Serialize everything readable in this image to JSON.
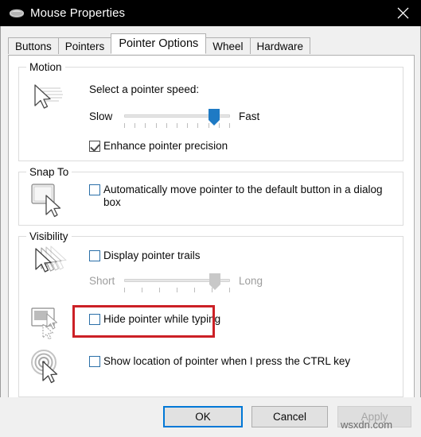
{
  "window": {
    "title": "Mouse Properties",
    "icon": "mouse-icon",
    "close_label": "✕",
    "titlebar_color": "#000000"
  },
  "tabs": [
    {
      "label": "Buttons",
      "active": false
    },
    {
      "label": "Pointers",
      "active": false
    },
    {
      "label": "Pointer Options",
      "active": true
    },
    {
      "label": "Wheel",
      "active": false
    },
    {
      "label": "Hardware",
      "active": false
    }
  ],
  "groups": {
    "motion": {
      "title": "Motion",
      "icon": "cursor-motion-icon",
      "speed_label": "Select a pointer speed:",
      "slider": {
        "min_label": "Slow",
        "max_label": "Fast",
        "value_percent": 85,
        "enabled": true,
        "thumb_color": "#1e7ac4",
        "tick_count": 11
      },
      "checkbox": {
        "label": "Enhance pointer precision",
        "checked": true
      }
    },
    "snapto": {
      "title": "Snap To",
      "icon": "cursor-button-icon",
      "checkbox": {
        "label": "Automatically move pointer to the default button in a dialog box",
        "checked": false
      }
    },
    "visibility": {
      "title": "Visibility",
      "trails": {
        "icon": "cursor-trails-icon",
        "checkbox": {
          "label": "Display pointer trails",
          "checked": false
        },
        "slider": {
          "min_label": "Short",
          "max_label": "Long",
          "value_percent": 86,
          "enabled": false,
          "thumb_color": "#c8c8c8",
          "tick_count": 7
        }
      },
      "hide_typing": {
        "icon": "cursor-typing-icon",
        "checkbox": {
          "label": "Hide pointer while typing",
          "checked": false
        }
      },
      "ctrl_locate": {
        "icon": "cursor-ctrl-locate-icon",
        "checkbox": {
          "label": "Show location of pointer when I press the CTRL key",
          "checked": false
        }
      }
    }
  },
  "annotation": {
    "color": "#cc2026",
    "targets": "Display pointer trails"
  },
  "buttons": {
    "ok": {
      "label": "OK",
      "enabled": true,
      "focused": true,
      "focus_color": "#0078d7"
    },
    "cancel": {
      "label": "Cancel",
      "enabled": true
    },
    "apply": {
      "label": "Apply",
      "enabled": false
    }
  },
  "watermark": {
    "text": "wsxdn.com"
  }
}
